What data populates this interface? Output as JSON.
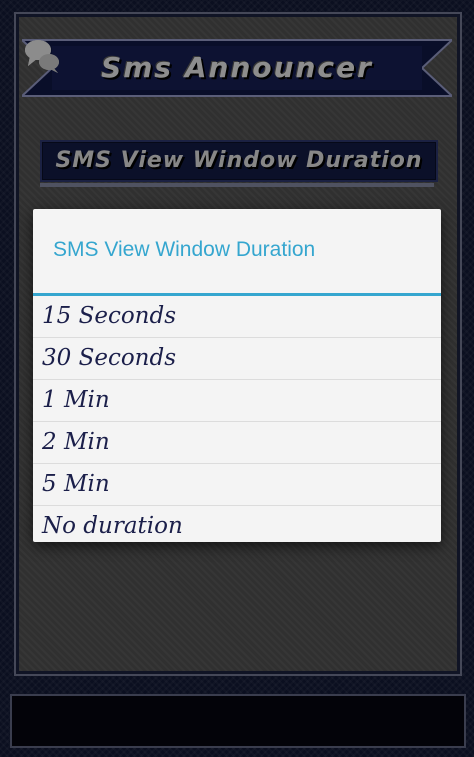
{
  "app": {
    "title": "Sms Announcer"
  },
  "screen": {
    "section_title": "SMS View Window Duration"
  },
  "dialog": {
    "title": "SMS View Window Duration",
    "options": [
      {
        "label": "15 Seconds"
      },
      {
        "label": "30 Seconds"
      },
      {
        "label": "1 Min"
      },
      {
        "label": "2 Min"
      },
      {
        "label": "5 Min"
      },
      {
        "label": "No duration"
      }
    ]
  },
  "colors": {
    "accent": "#35a6cf",
    "option_text": "#1b1f4a",
    "banner": "#121a3f"
  },
  "icons": {
    "header_left": "chat-bubbles-icon",
    "header_right": "chat-bubbles-icon"
  }
}
